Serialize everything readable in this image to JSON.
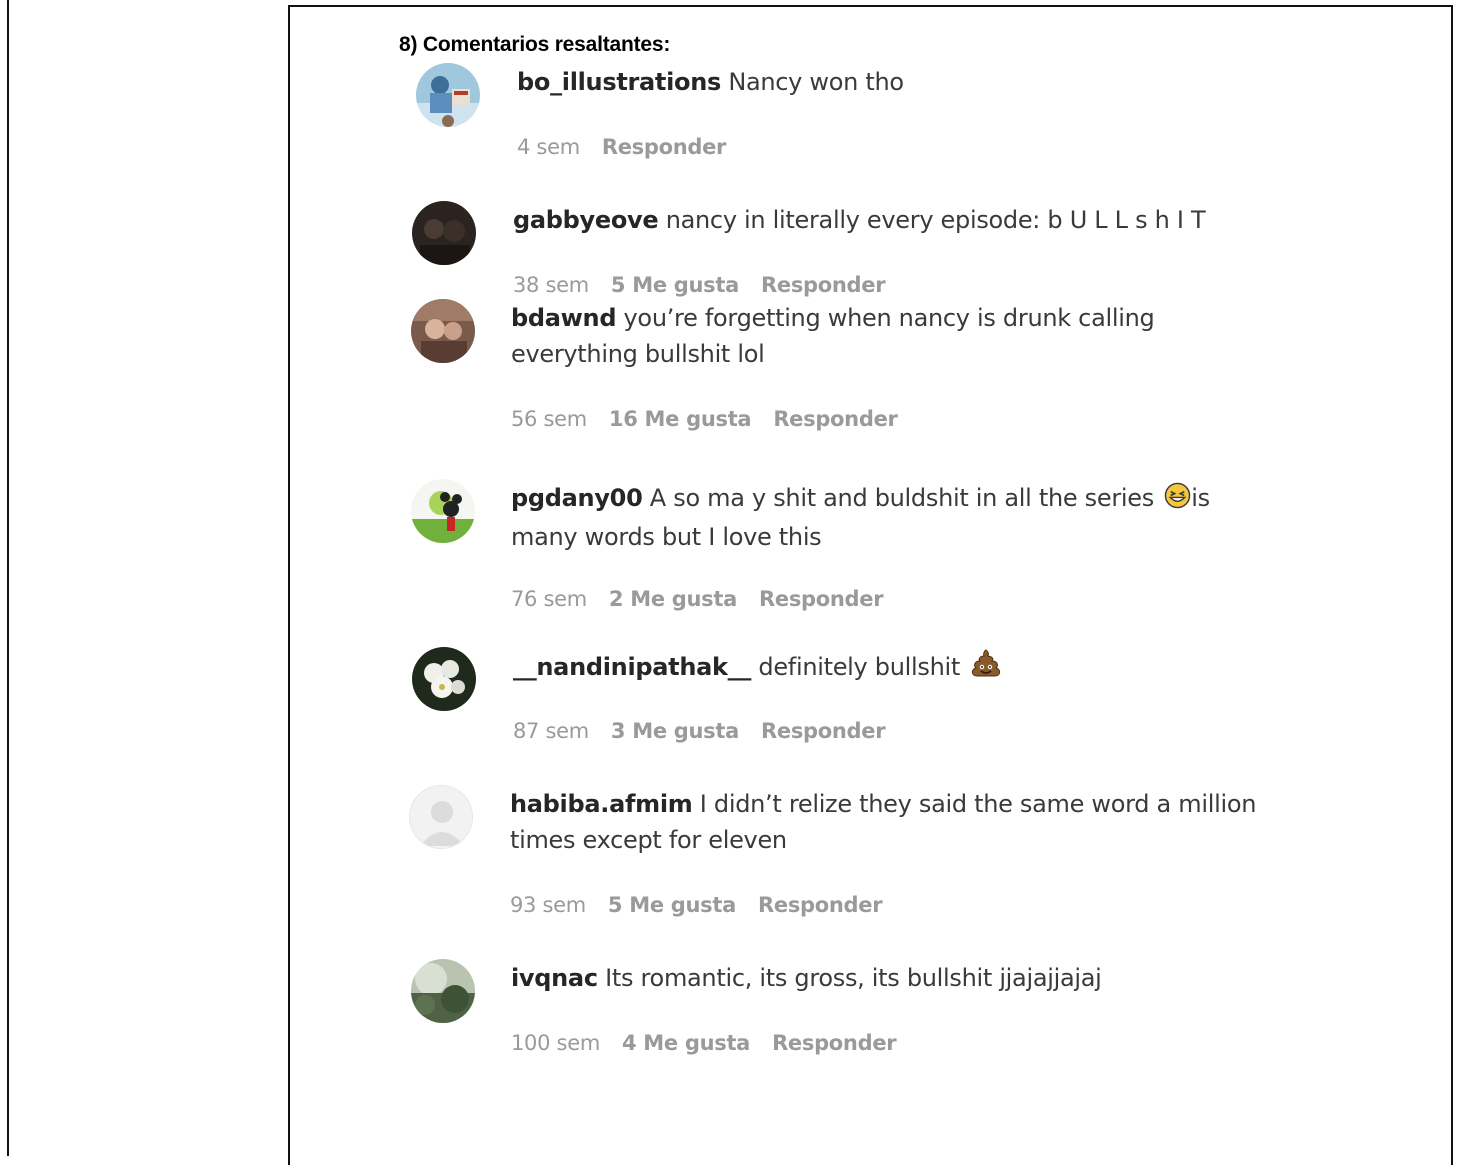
{
  "heading": "8) Comentarios resaltantes:",
  "comments": [
    {
      "user": "bo_illustrations",
      "text": " Nancy won tho",
      "time": "4 sem",
      "likes": "",
      "reply": "Responder"
    },
    {
      "user": "gabbyeove",
      "text": " nancy in literally every episode: b U L L s h I T",
      "time": "38 sem",
      "likes": "5 Me gusta",
      "reply": "Responder"
    },
    {
      "user": "bdawnd",
      "text": " you’re forgetting when nancy is drunk calling everything bullshit lol",
      "time": "56 sem",
      "likes": "16 Me gusta",
      "reply": "Responder"
    },
    {
      "user": "pgdany00",
      "text_a": " A so ma y shit and buldshit in all the series ",
      "text_b": "is many words but I love this",
      "time": "76 sem",
      "likes": "2 Me gusta",
      "reply": "Responder"
    },
    {
      "user": "__nandinipathak__",
      "text": " definitely bullshit ",
      "time": "87 sem",
      "likes": "3 Me gusta",
      "reply": "Responder"
    },
    {
      "user": "habiba.afmim",
      "text": " I didn’t relize they said the same word a million times except for eleven",
      "time": "93 sem",
      "likes": "5 Me gusta",
      "reply": "Responder"
    },
    {
      "user": "ivqnac",
      "text": " Its romantic, its gross, its bullshit jjajajjajaj",
      "time": "100 sem",
      "likes": "4 Me gusta",
      "reply": "Responder"
    }
  ],
  "icons": {
    "laugh_emoji": "grinning-squinting-face-icon",
    "poop_emoji": "pile-of-poo-icon"
  }
}
